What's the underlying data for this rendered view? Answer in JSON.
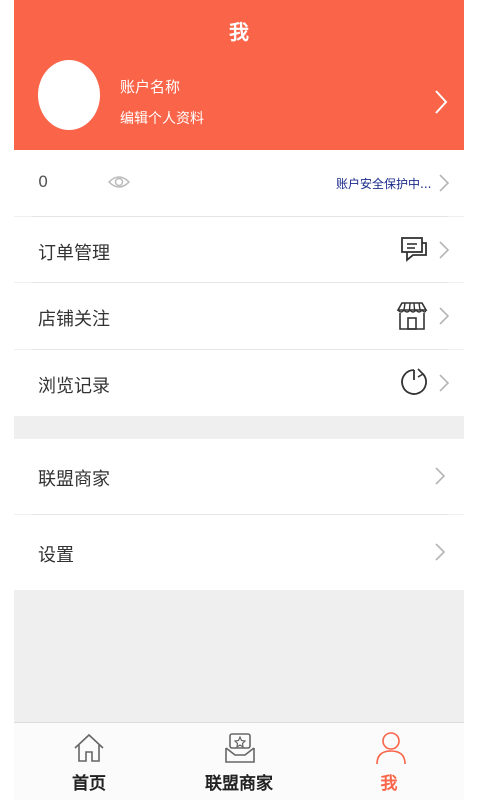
{
  "header": {
    "title": "我",
    "account_name": "账户名称",
    "edit_profile": "编辑个人资料"
  },
  "stats": {
    "value": "0",
    "security_status": "账户安全保护中..."
  },
  "menu": {
    "orders": "订单管理",
    "store_follow": "店铺关注",
    "history": "浏览记录",
    "alliance": "联盟商家",
    "settings": "设置"
  },
  "tabs": [
    {
      "label": "首页",
      "icon": "home-icon"
    },
    {
      "label": "联盟商家",
      "icon": "alliance-icon"
    },
    {
      "label": "我",
      "icon": "person-icon",
      "active": true
    }
  ],
  "colors": {
    "accent": "#fa6448",
    "security_text": "#1a2b8a",
    "background": "#efefef"
  }
}
